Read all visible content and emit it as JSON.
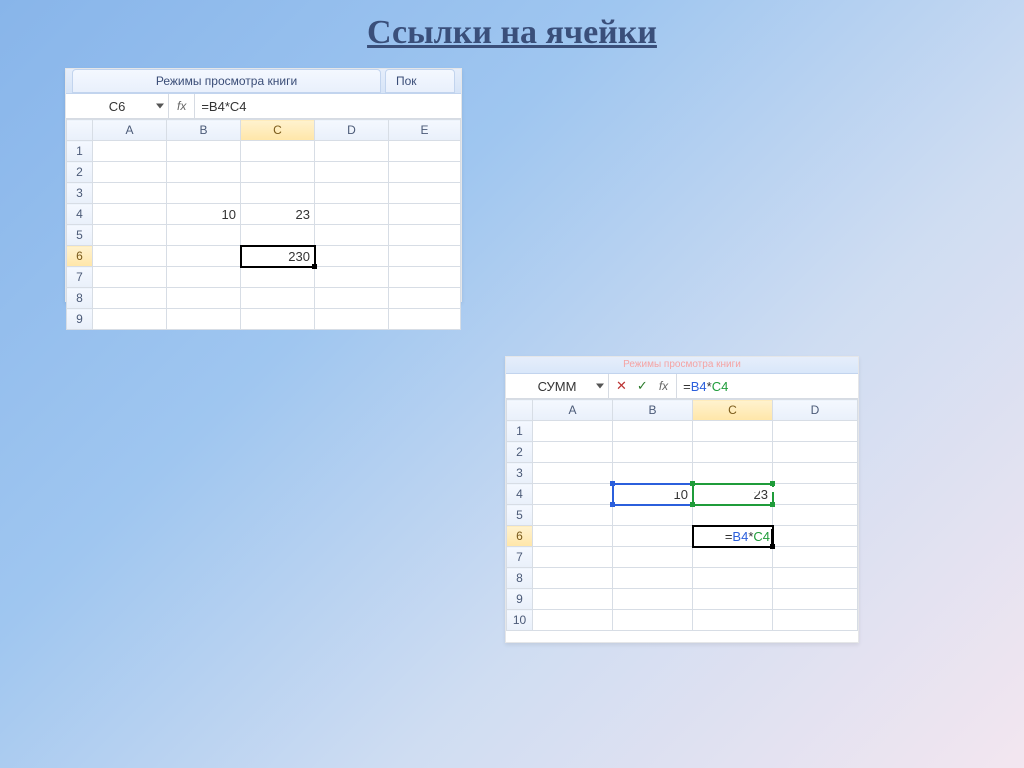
{
  "slide": {
    "title": "Ссылки на ячейки"
  },
  "shot1": {
    "ribbon": {
      "tab_mode": "Режимы просмотра книги",
      "tab_show_truncated": "Пок"
    },
    "namebox": "C6",
    "fx_label": "fx",
    "formula": "=B4*C4",
    "columns": [
      "A",
      "B",
      "C",
      "D",
      "E"
    ],
    "active_row": 6,
    "active_col": "C",
    "rows": [
      {
        "n": 1,
        "cells": [
          "",
          "",
          "",
          "",
          ""
        ]
      },
      {
        "n": 2,
        "cells": [
          "",
          "",
          "",
          "",
          ""
        ]
      },
      {
        "n": 3,
        "cells": [
          "",
          "",
          "",
          "",
          ""
        ]
      },
      {
        "n": 4,
        "cells": [
          "",
          "10",
          "23",
          "",
          ""
        ]
      },
      {
        "n": 5,
        "cells": [
          "",
          "",
          "",
          "",
          ""
        ]
      },
      {
        "n": 6,
        "cells": [
          "",
          "",
          "230",
          "",
          ""
        ]
      },
      {
        "n": 7,
        "cells": [
          "",
          "",
          "",
          "",
          ""
        ]
      },
      {
        "n": 8,
        "cells": [
          "",
          "",
          "",
          "",
          ""
        ]
      },
      {
        "n": 9,
        "cells": [
          "",
          "",
          "",
          "",
          ""
        ]
      }
    ]
  },
  "shot2": {
    "stub_label": "Режимы просмотра книги",
    "namebox": "СУММ",
    "fx_label": "fx",
    "cancel_glyph": "✕",
    "accept_glyph": "✓",
    "formula_tokens": {
      "eq": "=",
      "ref1": "B4",
      "op": "*",
      "ref2": "C4"
    },
    "columns": [
      "A",
      "B",
      "C",
      "D"
    ],
    "active_row": 6,
    "active_col": "C",
    "edit_tokens": {
      "eq": "=",
      "ref1": "B4",
      "op": "*",
      "ref2": "C4"
    },
    "rows": [
      {
        "n": 1,
        "cells": [
          "",
          "",
          "",
          ""
        ]
      },
      {
        "n": 2,
        "cells": [
          "",
          "",
          "",
          ""
        ]
      },
      {
        "n": 3,
        "cells": [
          "",
          "",
          "",
          ""
        ]
      },
      {
        "n": 4,
        "cells": [
          "",
          "10",
          "23",
          ""
        ]
      },
      {
        "n": 5,
        "cells": [
          "",
          "",
          "",
          ""
        ]
      },
      {
        "n": 6,
        "cells": [
          "",
          "",
          "",
          ""
        ]
      },
      {
        "n": 7,
        "cells": [
          "",
          "",
          "",
          ""
        ]
      },
      {
        "n": 8,
        "cells": [
          "",
          "",
          "",
          ""
        ]
      },
      {
        "n": 9,
        "cells": [
          "",
          "",
          "",
          ""
        ]
      },
      {
        "n": 10,
        "cells": [
          "",
          "",
          "",
          ""
        ]
      }
    ]
  }
}
